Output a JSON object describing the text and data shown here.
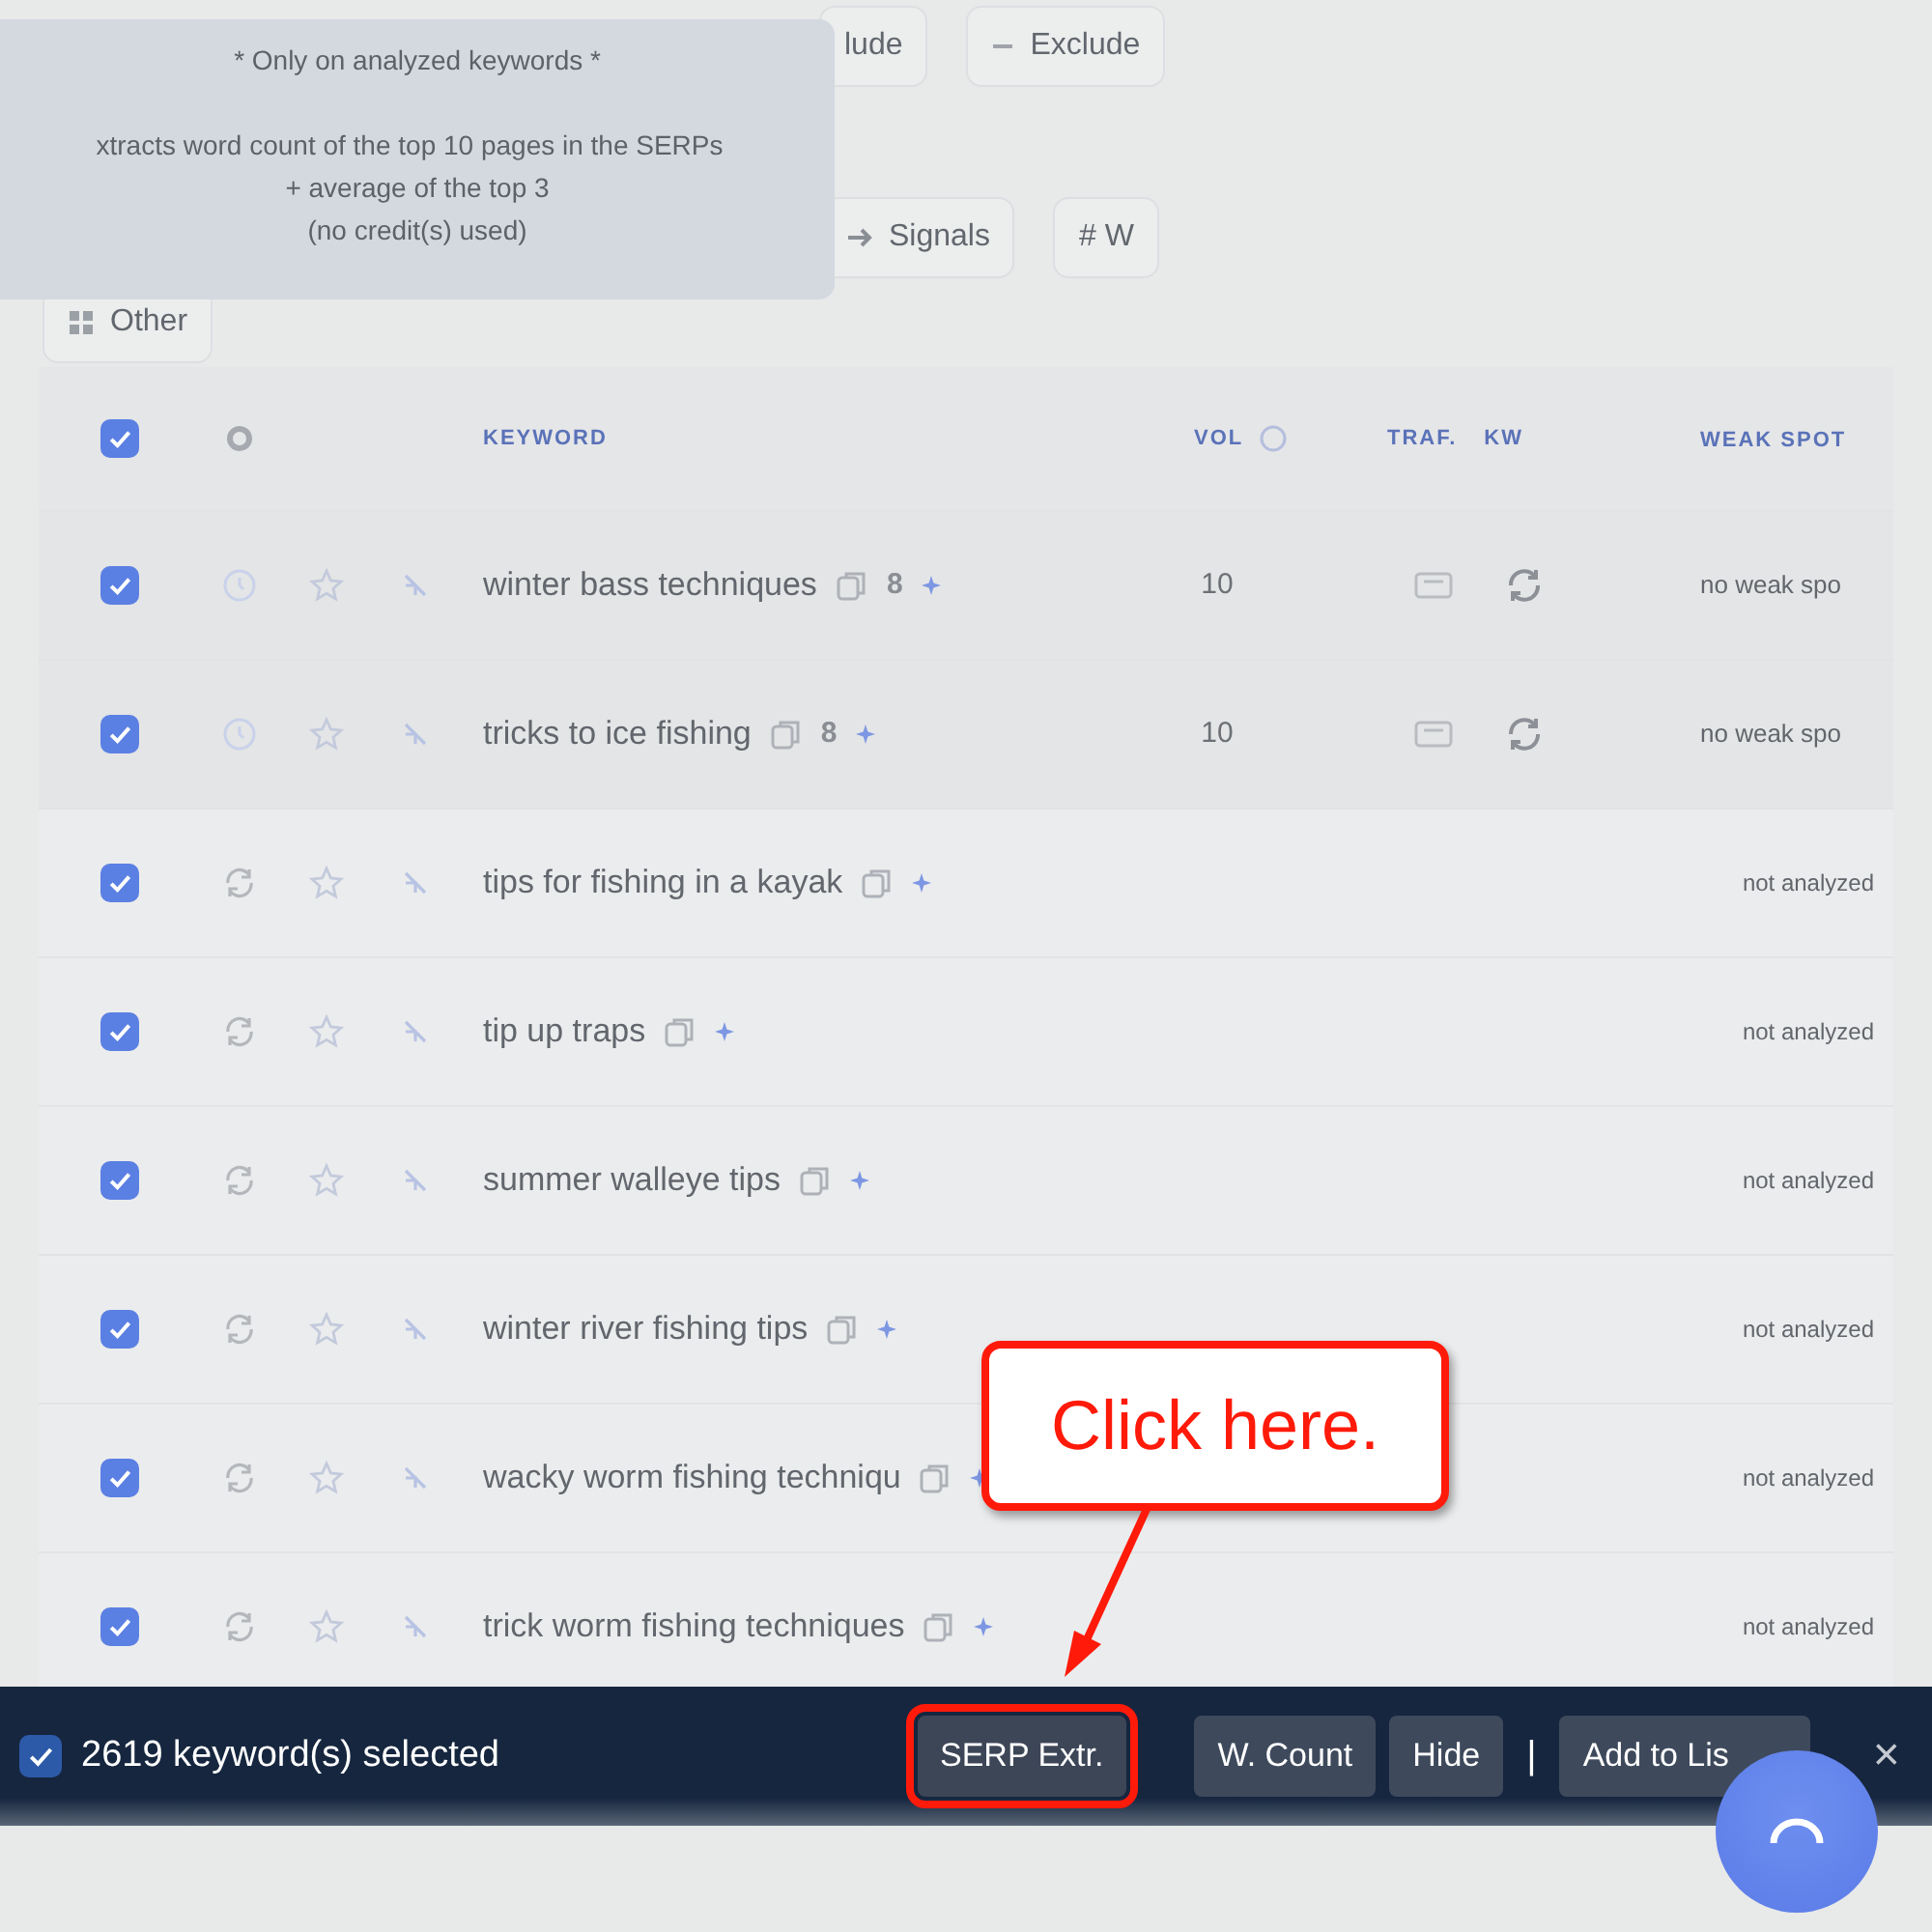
{
  "tooltip": {
    "lines": [
      "* Only on analyzed keywords *",
      "xtracts word count of the top 10 pages in the SERPs",
      "+ average of the top 3",
      "(no credit(s) used)"
    ]
  },
  "filters": [
    {
      "label": "lude",
      "kind": "plain"
    },
    {
      "label": "Exclude",
      "kind": "minus"
    },
    {
      "label": "Signals",
      "kind": "arrow"
    },
    {
      "label": "# W",
      "kind": "plain"
    },
    {
      "label": "Other",
      "kind": "grid"
    }
  ],
  "table": {
    "header_checked": true,
    "columns": [
      "KEYWORD",
      "VOL",
      "TRAF.",
      "KW",
      "WEAK SPOT"
    ],
    "rows": [
      {
        "checked": true,
        "analyzed": true,
        "keyword": "winter bass techniques",
        "badge": "8",
        "volume": "10",
        "weak_spots": "no weak spo"
      },
      {
        "checked": true,
        "analyzed": true,
        "keyword": "tricks to ice fishing",
        "badge": "8",
        "volume": "10",
        "weak_spots": "no weak spo"
      },
      {
        "checked": true,
        "analyzed": false,
        "keyword": "tips for fishing in a kayak",
        "weak_spots": "not analyzed"
      },
      {
        "checked": true,
        "analyzed": false,
        "keyword": "tip up traps",
        "weak_spots": "not analyzed"
      },
      {
        "checked": true,
        "analyzed": false,
        "keyword": "summer walleye tips",
        "weak_spots": "not analyzed"
      },
      {
        "checked": true,
        "analyzed": false,
        "keyword": "winter river fishing tips",
        "weak_spots": "not analyzed"
      },
      {
        "checked": true,
        "analyzed": false,
        "keyword": "wacky worm fishing techniqu",
        "weak_spots": "not analyzed"
      },
      {
        "checked": true,
        "analyzed": false,
        "keyword": "trick worm fishing techniques",
        "weak_spots": "not analyzed"
      }
    ]
  },
  "selection_bar": {
    "checked": true,
    "count_text": "2619 keyword(s) selected",
    "buttons": [
      {
        "label": "SERP Extr.",
        "highlighted": true
      },
      {
        "label": "W. Count",
        "highlighted": false
      },
      {
        "label": "Hide",
        "highlighted": false
      },
      {
        "label": "Add to Lis",
        "highlighted": false
      }
    ],
    "separator": "|",
    "close": "×"
  },
  "callout": {
    "text": "Click here."
  }
}
